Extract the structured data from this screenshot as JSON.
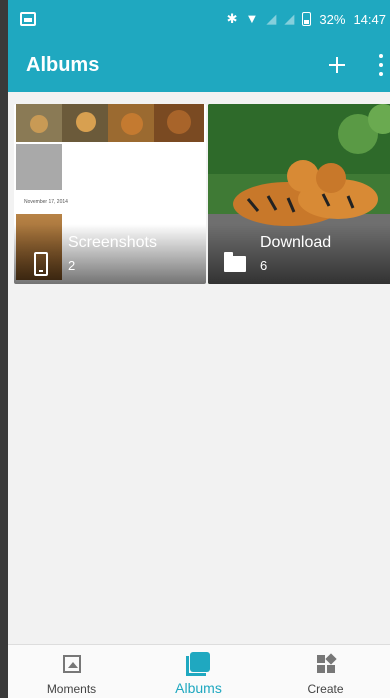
{
  "status_bar": {
    "notification_icon": "image-notification-icon",
    "bluetooth_glyph": "✱",
    "wifi_glyph": "▼",
    "battery_percent": "32%",
    "time": "14:47"
  },
  "app_bar": {
    "title": "Albums",
    "add_icon": "plus-icon",
    "more_icon": "more-vert-icon"
  },
  "albums": [
    {
      "name": "Screenshots",
      "count": "2",
      "icon": "phone-icon",
      "thumb_date": "November 17, 2014"
    },
    {
      "name": "Download",
      "count": "6",
      "icon": "folder-icon"
    }
  ],
  "bottom_nav": [
    {
      "label": "Moments",
      "icon": "moments-icon",
      "active": false
    },
    {
      "label": "Albums",
      "icon": "albums-icon",
      "active": true
    },
    {
      "label": "Create",
      "icon": "create-icon",
      "active": false
    }
  ],
  "colors": {
    "accent": "#1fa8c0",
    "background": "#f2f2f2"
  }
}
